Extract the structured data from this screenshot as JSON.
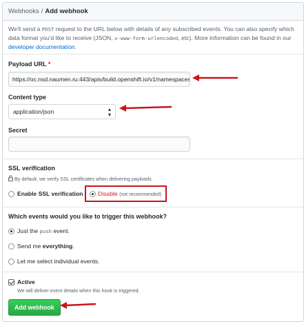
{
  "breadcrumb": {
    "parent": "Webhooks",
    "separator": "/",
    "current": "Add webhook"
  },
  "intro": {
    "text1": "We'll send a ",
    "code1": "POST",
    "text2": " request to the URL below with details of any subscribed events. You can also specify which data format you'd like to receive (JSON, ",
    "code2": "x-www-form-urlencoded",
    "text3": ", etc). More information can be found in our ",
    "link": "developer documentation",
    "text4": "."
  },
  "payload_url": {
    "label": "Payload URL",
    "required_mark": "*",
    "value": "https://oc.nsd.naumen.ru:443/apis/build.openshift.io/v1/namespaces"
  },
  "content_type": {
    "label": "Content type",
    "selected": "application/json"
  },
  "secret": {
    "label": "Secret",
    "value": ""
  },
  "ssl": {
    "heading": "SSL verification",
    "note": "By default, we verify SSL certificates when delivering payloads.",
    "enable_label": "Enable SSL verification",
    "disable_label": "Disable",
    "disable_note": "(not recommended)"
  },
  "events": {
    "heading": "Which events would you like to trigger this webhook?",
    "opt1_pre": "Just the ",
    "opt1_code": "push",
    "opt1_post": " event.",
    "opt2_pre": "Send me ",
    "opt2_bold": "everything",
    "opt2_post": ".",
    "opt3": "Let me select individual events."
  },
  "active": {
    "label": "Active",
    "note": "We will deliver event details when this hook is triggered."
  },
  "submit_label": "Add webhook",
  "colors": {
    "accent": "#0366d6",
    "primary": "#28a745",
    "annotation": "#c8151b"
  }
}
